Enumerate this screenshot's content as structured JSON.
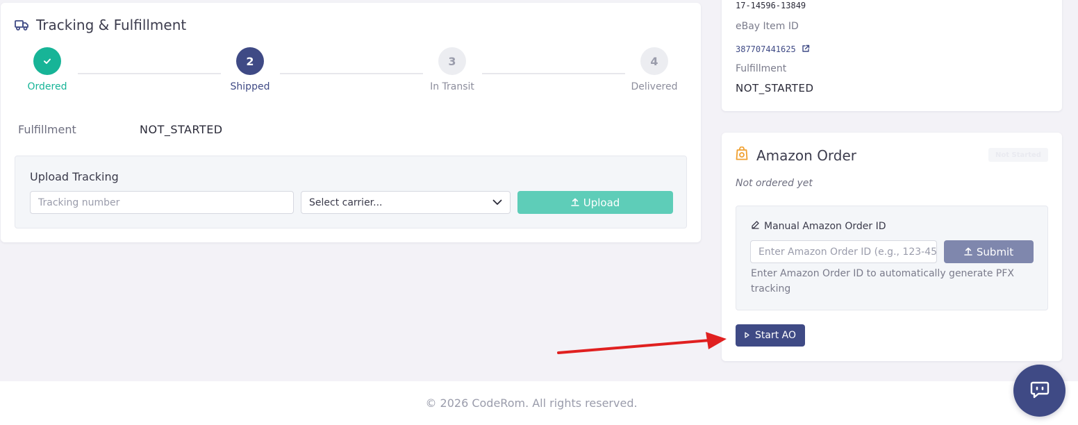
{
  "tracking": {
    "title": "Tracking & Fulfillment",
    "steps": [
      {
        "number": "",
        "label": "Ordered",
        "state": "done"
      },
      {
        "number": "2",
        "label": "Shipped",
        "state": "active"
      },
      {
        "number": "3",
        "label": "In Transit",
        "state": "pending"
      },
      {
        "number": "4",
        "label": "Delivered",
        "state": "pending"
      }
    ],
    "fulfillment_label": "Fulfillment",
    "fulfillment_value": "NOT_STARTED",
    "upload": {
      "title": "Upload Tracking",
      "tracking_placeholder": "Tracking number",
      "carrier_value": "Select carrier...",
      "button_label": "Upload"
    }
  },
  "details": {
    "order_number": "17-14596-13849",
    "ebay_item_label": "eBay Item ID",
    "ebay_item_id": "387707441625",
    "fulfillment_label": "Fulfillment",
    "fulfillment_value": "NOT_STARTED"
  },
  "amazon": {
    "title": "Amazon Order",
    "badge": "Not Started",
    "status_text": "Not ordered yet",
    "manual": {
      "title": "Manual Amazon Order ID",
      "placeholder": "Enter Amazon Order ID (e.g., 123-45",
      "submit_label": "Submit",
      "helper": "Enter Amazon Order ID to automatically generate PFX tracking"
    },
    "start_button": "Start AO"
  },
  "footer": {
    "copyright": "© 2026 CodeRom. All rights reserved."
  },
  "colors": {
    "primary": "#3f4a85",
    "success": "#17b497",
    "upload_button": "#5ecdb8",
    "amazon_icon": "#f0a030",
    "annotation_arrow": "#e02020"
  }
}
